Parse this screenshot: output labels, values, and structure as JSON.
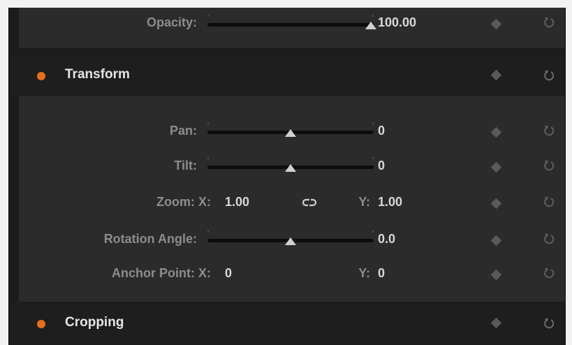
{
  "opacity": {
    "label": "Opacity:",
    "value": "100.00",
    "level": 1.0
  },
  "transform": {
    "title": "Transform",
    "pan": {
      "label": "Pan:",
      "value": "0",
      "level": 0.5
    },
    "tilt": {
      "label": "Tilt:",
      "value": "0",
      "level": 0.5
    },
    "zoom": {
      "label": "Zoom: X:",
      "x_value": "1.00",
      "y_label": "Y:",
      "y_value": "1.00"
    },
    "rotation": {
      "label": "Rotation Angle:",
      "value": "0.0",
      "level": 0.5
    },
    "anchor": {
      "label": "Anchor Point: X:",
      "x_value": "0",
      "y_label": "Y:",
      "y_value": "0"
    }
  },
  "cropping": {
    "title": "Cropping"
  },
  "icons": {
    "keyframe": "keyframe-diamond-icon",
    "reset": "reset-icon",
    "link": "link-chain-icon"
  },
  "colors": {
    "accent_dot": "#e86d1f"
  }
}
